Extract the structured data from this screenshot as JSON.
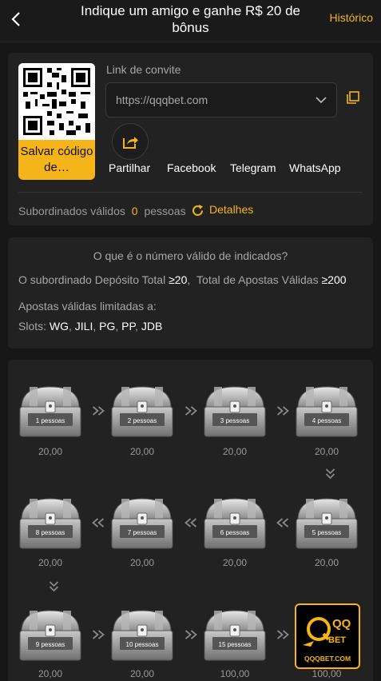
{
  "header": {
    "title": "Indique um amigo e ganhe R$ 20 de bônus",
    "history": "Histórico"
  },
  "invite": {
    "save_label": "Salvar código de…",
    "link_label": "Link de convite",
    "link_value": "https://qqqbet.com",
    "share_options": [
      "Partilhar",
      "Facebook",
      "Telegram",
      "WhatsApp"
    ]
  },
  "subordinates": {
    "label": "Subordinados válidos",
    "count": "0",
    "unit": "pessoas",
    "details": "Detalhes"
  },
  "rules": {
    "title": "O que é o número válido de indicados?",
    "requirement_prefix": "O subordinado Depósito Total",
    "deposit_min": "≥20",
    "requirement_mid": "Total de Apostas Válidas",
    "bets_min": "≥200",
    "limited_label": "Apostas válidas limitadas a:",
    "slots_label": "Slots:",
    "slots": [
      "WG",
      "JILI",
      "PG",
      "PP",
      "JDB"
    ]
  },
  "rewards": [
    {
      "people": "1 pessoas",
      "amount": "20,00"
    },
    {
      "people": "2 pessoas",
      "amount": "20,00"
    },
    {
      "people": "3 pessoas",
      "amount": "20,00"
    },
    {
      "people": "4 pessoas",
      "amount": "20,00"
    },
    {
      "people": "5 pessoas",
      "amount": "20,00"
    },
    {
      "people": "6 pessoas",
      "amount": "20,00"
    },
    {
      "people": "7 pessoas",
      "amount": "20,00"
    },
    {
      "people": "8 pessoas",
      "amount": "20,00"
    },
    {
      "people": "9 pessoas",
      "amount": "20,00"
    },
    {
      "people": "10 pessoas",
      "amount": "20,00"
    },
    {
      "people": "15 pessoas",
      "amount": "100,00"
    },
    {
      "people": "",
      "amount": "100,00"
    }
  ],
  "brand": {
    "logo_text": "QQBET",
    "logo_url_text": "QQQBET.COM",
    "accent": "#f5b41a"
  }
}
